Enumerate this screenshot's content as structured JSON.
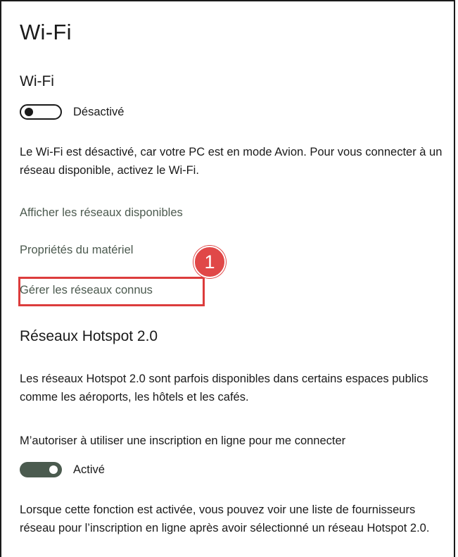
{
  "page": {
    "title": "Wi-Fi"
  },
  "wifi": {
    "heading": "Wi-Fi",
    "toggle_state": "Désactivé",
    "description": "Le Wi-Fi est désactivé, car votre PC est en mode Avion. Pour vous connecter à un réseau disponible, activez le Wi-Fi."
  },
  "links": {
    "show_networks": "Afficher les réseaux disponibles",
    "hardware_properties": "Propriétés du matériel",
    "manage_known": "Gérer les réseaux connus"
  },
  "annotation": {
    "number": "1",
    "color": "#dc3c3c"
  },
  "hotspot": {
    "heading": "Réseaux Hotspot 2.0",
    "description": "Les réseaux Hotspot 2.0 sont parfois disponibles dans certains espaces publics comme les aéroports, les hôtels et les cafés.",
    "setting_label": "M’autoriser à utiliser une inscription en ligne pour me connecter",
    "toggle_state": "Activé",
    "footer_text": "Lorsque cette fonction est activée, vous pouvez voir une liste de fournisseurs réseau pour l’inscription en ligne après avoir sélectionné un réseau Hotspot 2.0."
  },
  "colors": {
    "accent_toggle": "#4b5b4f",
    "link": "#4c5a4f"
  }
}
